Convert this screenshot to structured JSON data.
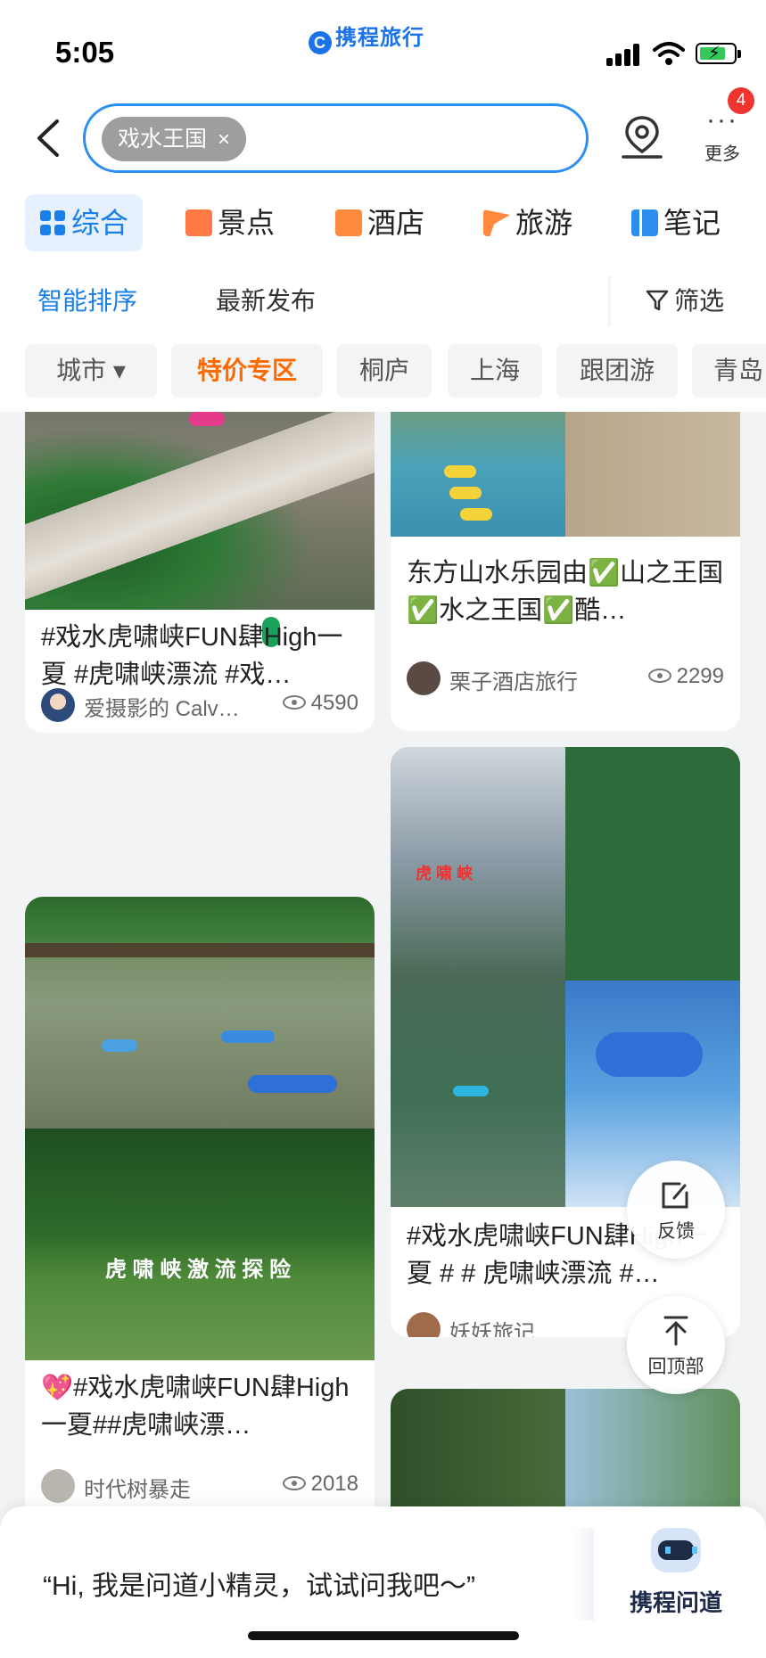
{
  "status_bar": {
    "time": "5:05",
    "brand": "携程旅行"
  },
  "search": {
    "query_chip": "戏水王国",
    "clear": "×"
  },
  "more": {
    "dots": "···",
    "label": "更多",
    "badge": "4"
  },
  "tabs": [
    {
      "label": "综合",
      "active": true,
      "icon": "grid-icon",
      "color": "#1a7fe8"
    },
    {
      "label": "景点",
      "active": false,
      "icon": "ticket-icon",
      "color": "#ff7a45"
    },
    {
      "label": "酒店",
      "active": false,
      "icon": "hotel-icon",
      "color": "#ff8a3d"
    },
    {
      "label": "旅游",
      "active": false,
      "icon": "flag-icon",
      "color": "#ff8a3d"
    },
    {
      "label": "笔记",
      "active": false,
      "icon": "notes-icon",
      "color": "#2b8ef0"
    }
  ],
  "sort": {
    "smart": "智能排序",
    "latest": "最新发布",
    "filter": "筛选"
  },
  "filters": {
    "city": "城市 ▾",
    "items": [
      "特价专区",
      "桐庐",
      "上海",
      "跟团游",
      "青岛"
    ]
  },
  "feed": {
    "left": [
      {
        "title": "#戏水虎啸峡FUN肆High一夏 #虎啸峡漂流 #戏…",
        "author": "爱摄影的 Calv…",
        "views": "4590"
      },
      {
        "title": "💖#戏水虎啸峡FUN肆High一夏##虎啸峡漂…",
        "author": "时代树暴走",
        "views": "2018",
        "sign_text": "虎 啸 峡 激 流 探 险"
      }
    ],
    "right": [
      {
        "title": "东方山水乐园由✅山之王国✅水之王国✅酷…",
        "author": "栗子酒店旅行",
        "views": "2299"
      },
      {
        "title": "#戏水虎啸峡FUN肆High一夏 # # 虎啸峡漂流 #…",
        "author": "妖妖旅记",
        "gate_text": "虎 啸 峡"
      }
    ]
  },
  "fab": {
    "feedback": "反馈",
    "top": "回顶部"
  },
  "assistant": {
    "prompt": "“Hi, 我是问道小精灵，试试问我吧～”",
    "name": "携程问道"
  }
}
